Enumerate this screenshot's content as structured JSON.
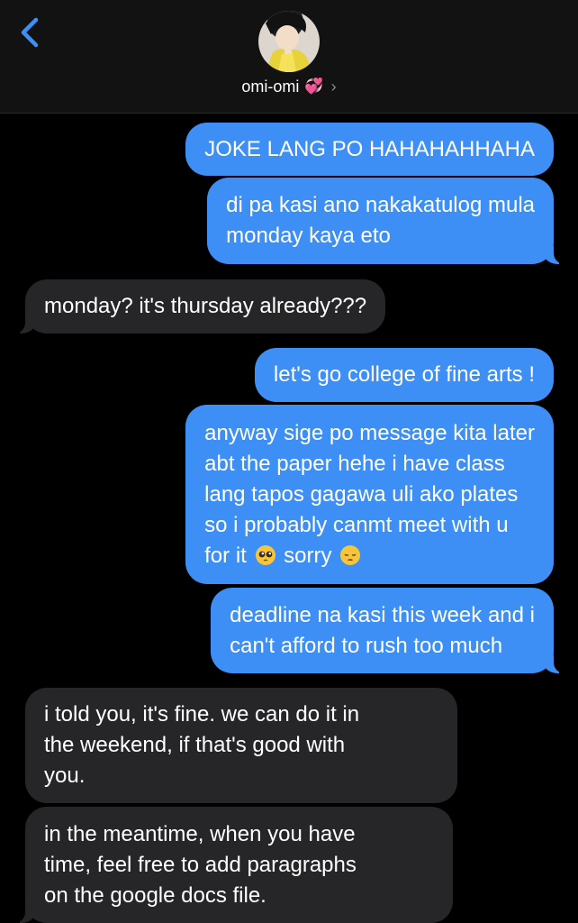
{
  "header": {
    "contact_name": "omi-omi",
    "name_emoji": "💞",
    "chevron": "›",
    "back_icon": "chevron-left-icon",
    "accent_color": "#3d8ff5"
  },
  "messages": [
    {
      "side": "sent",
      "lines": [
        "JOKE LANG PO HAHAHAHHAHA"
      ]
    },
    {
      "side": "sent",
      "lines": [
        "di pa kasi ano nakakatulog mula",
        "monday kaya eto"
      ]
    },
    {
      "side": "received",
      "lines": [
        "monday? it's thursday already???"
      ]
    },
    {
      "side": "sent",
      "lines": [
        "let's go college of fine arts !"
      ]
    },
    {
      "side": "sent",
      "lines": [
        "anyway sige po message kita later",
        "abt the paper hehe i have class",
        "lang tapos gagawa uli ako plates",
        "so i probably canmt meet with u",
        "for it",
        "sorry"
      ],
      "emojis": [
        "pleading-face-icon",
        "pensive-face-icon"
      ]
    },
    {
      "side": "sent",
      "lines": [
        "deadline na kasi this week and i",
        "can't afford to rush too much"
      ]
    },
    {
      "side": "received",
      "lines": [
        "i told you, it's fine. we can do it in",
        "the weekend, if that's good with",
        "you."
      ]
    },
    {
      "side": "received",
      "lines": [
        "in the meantime, when you have",
        "time, feel free to add paragraphs",
        "on the google docs file."
      ]
    }
  ],
  "colors": {
    "sent_bubble": "#3d8ff5",
    "received_bubble": "#262628",
    "background": "#000000",
    "header_background": "#121212"
  }
}
